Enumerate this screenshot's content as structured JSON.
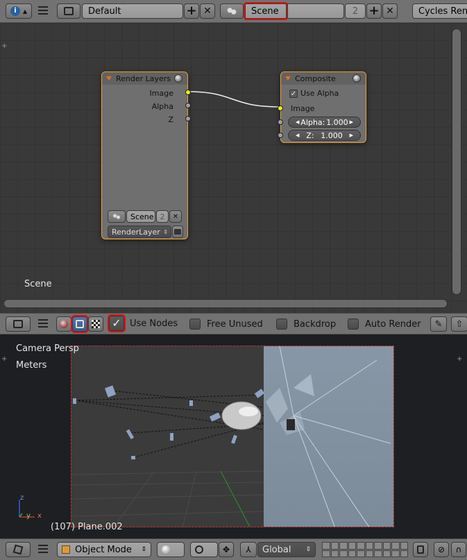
{
  "top_header": {
    "layout_name": "Default",
    "scene_name": "Scene",
    "scene_users": "2",
    "render_engine": "Cycles Ren"
  },
  "node_editor": {
    "render_layers_node": {
      "title": "Render Layers",
      "outputs": [
        "Image",
        "Alpha",
        "Z"
      ],
      "scene_field": "Scene",
      "scene_users": "2",
      "layer_field": "RenderLayer"
    },
    "composite_node": {
      "title": "Composite",
      "use_alpha_label": "Use Alpha",
      "image_label": "Image",
      "alpha_label": "Alpha:",
      "alpha_value": "1.000",
      "z_label": "Z:",
      "z_value": "1.000"
    },
    "scene_label": "Scene"
  },
  "node_header": {
    "use_nodes_label": "Use Nodes",
    "free_unused_label": "Free Unused",
    "backdrop_label": "Backdrop",
    "auto_render_label": "Auto Render"
  },
  "viewport": {
    "view_label": "Camera Persp",
    "units_label": "Meters",
    "object_label": "(107) Plane.002",
    "axis_z": "z",
    "axis_y": "y",
    "axis_x": "x"
  },
  "bottom_header": {
    "mode": "Object Mode",
    "orientation": "Global"
  }
}
